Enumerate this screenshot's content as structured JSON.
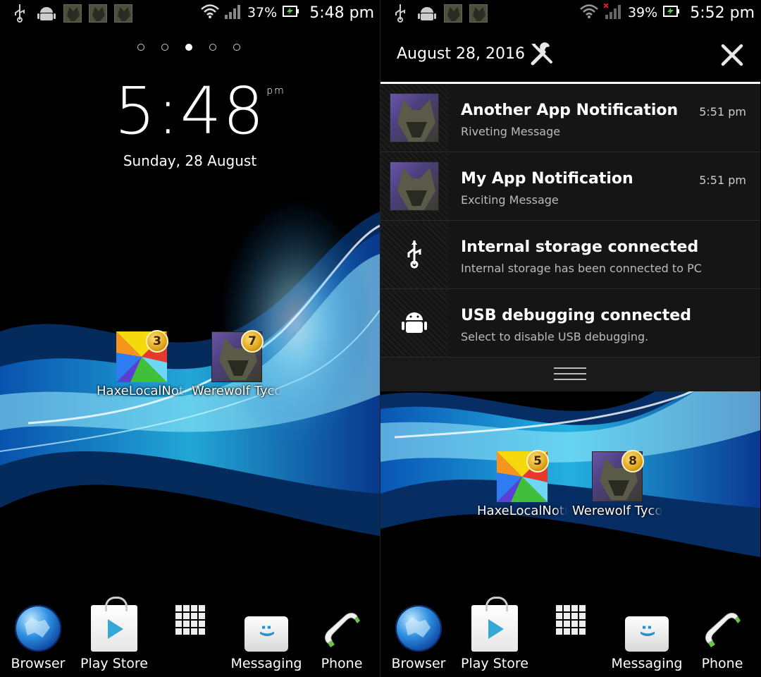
{
  "left": {
    "status": {
      "battery_pct": "37%",
      "time": "5:48 pm"
    },
    "clock": {
      "time": "5:48",
      "ampm": "pm",
      "date": "Sunday, 28 August"
    },
    "page_dots": {
      "count": 5,
      "active_index": 2
    },
    "apps": [
      {
        "label": "HaxeLocalNotifications",
        "badge": "3",
        "icon": "haxe-logo-icon"
      },
      {
        "label": "Werewolf Tycoon",
        "badge": "7",
        "icon": "werewolf-icon"
      }
    ]
  },
  "right": {
    "status": {
      "battery_pct": "39%",
      "time": "5:52 pm"
    },
    "shade": {
      "date": "August 28, 2016",
      "notifications": [
        {
          "title": "Another App Notification",
          "subtitle": "Riveting Message",
          "time": "5:51 pm",
          "icon": "werewolf-icon"
        },
        {
          "title": "My App Notification",
          "subtitle": "Exciting Message",
          "time": "5:51 pm",
          "icon": "werewolf-icon"
        },
        {
          "title": "Internal storage connected",
          "subtitle": "Internal storage has been connected to PC",
          "time": "",
          "icon": "usb-icon"
        },
        {
          "title": "USB debugging connected",
          "subtitle": "Select to disable USB debugging.",
          "time": "",
          "icon": "android-icon"
        }
      ]
    },
    "apps": [
      {
        "label": "HaxeLocalNotifications",
        "badge": "5",
        "icon": "haxe-logo-icon"
      },
      {
        "label": "Werewolf Tycoon",
        "badge": "8",
        "icon": "werewolf-icon"
      }
    ]
  },
  "dock": {
    "items": [
      {
        "label": "Browser",
        "icon": "globe-icon"
      },
      {
        "label": "Play Store",
        "icon": "play-store-icon"
      },
      {
        "label": "",
        "icon": "app-drawer-icon"
      },
      {
        "label": "Messaging",
        "icon": "messaging-icon"
      },
      {
        "label": "Phone",
        "icon": "phone-icon"
      }
    ]
  },
  "colors": {
    "accent_blue": "#2ba6ff",
    "badge_gold": "#e0a419"
  }
}
